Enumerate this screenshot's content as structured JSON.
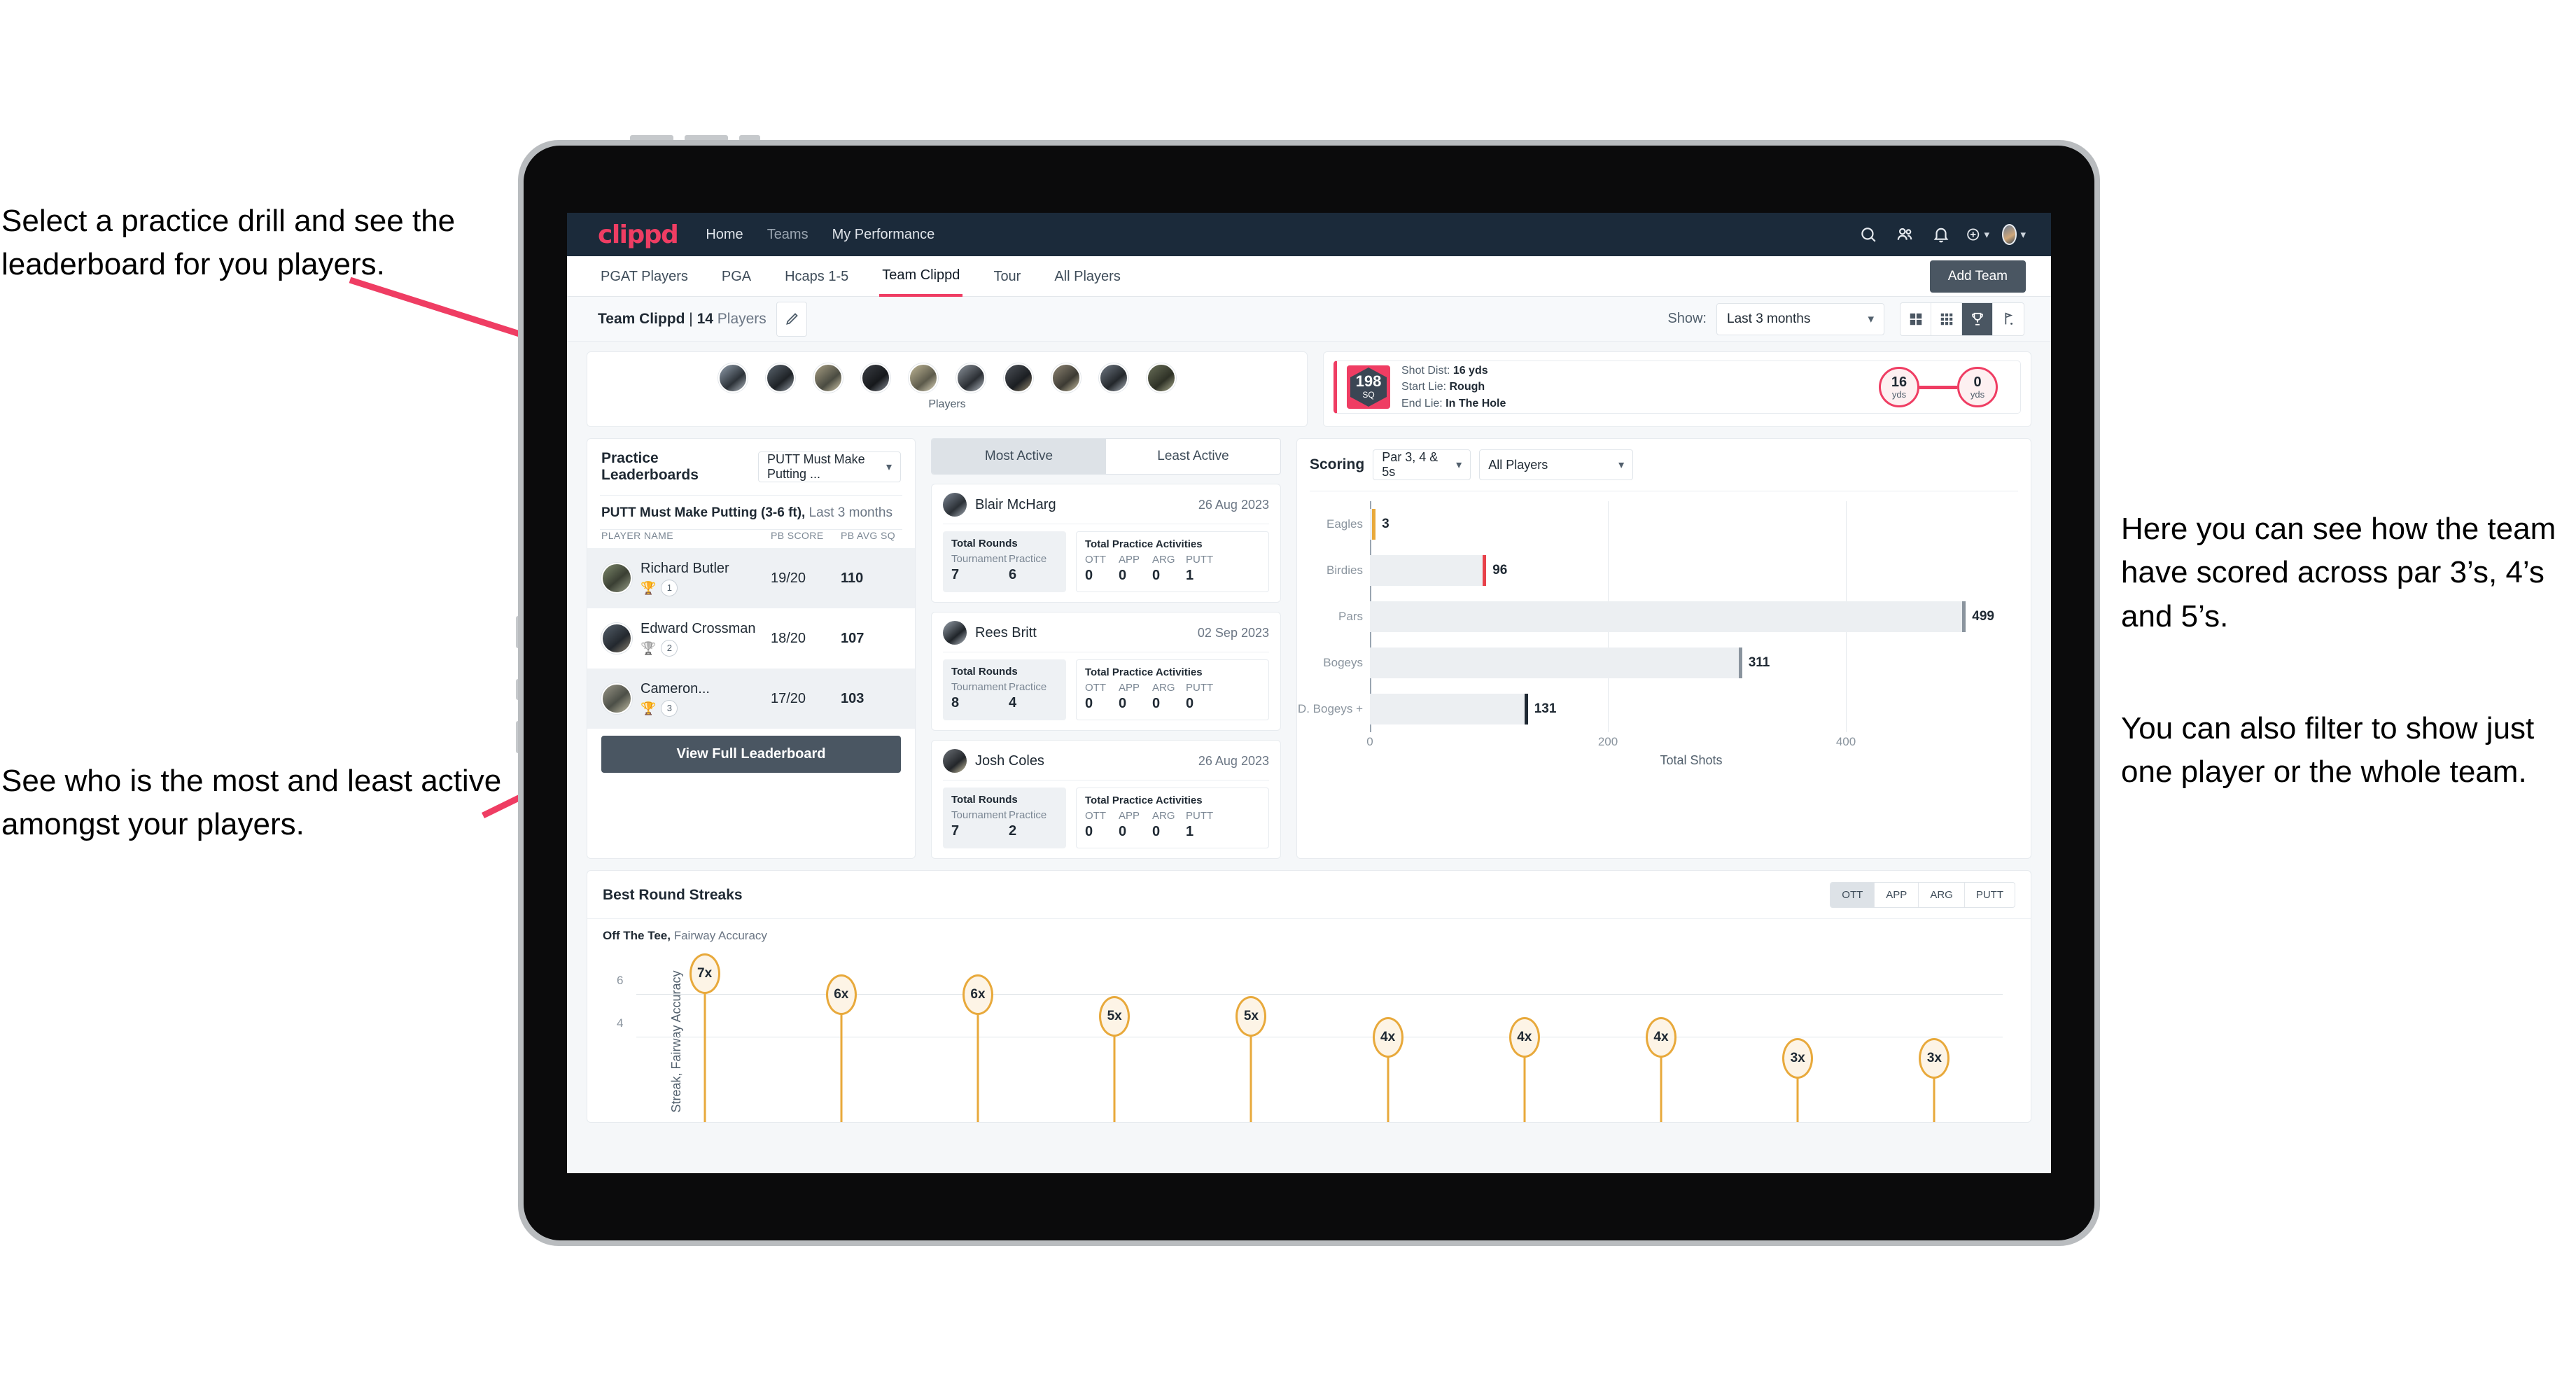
{
  "annotations": {
    "select_drill": "Select a practice drill and see the leaderboard for you players.",
    "most_least": "See who is the most and least active amongst your players.",
    "scoring": "Here you can see how the team have scored across par 3’s, 4’s and 5’s.",
    "filter": "You can also filter to show just one player or the whole team."
  },
  "colors": {
    "brand_pink": "#ef3d63",
    "navbar_dark": "#1b2a3a",
    "button_slate": "#4a5662",
    "amber": "#e8a93b"
  },
  "topnav": {
    "logo": "clippd",
    "links": [
      {
        "label": "Home",
        "active": true
      },
      {
        "label": "Teams",
        "active": false
      },
      {
        "label": "My Performance",
        "active": false
      }
    ],
    "icons": [
      "search-icon",
      "people-icon",
      "bell-icon",
      "plus-circle-icon",
      "avatar-icon"
    ]
  },
  "tabbar": {
    "tabs": [
      {
        "label": "PGAT Players",
        "active": false
      },
      {
        "label": "PGA",
        "active": false
      },
      {
        "label": "Hcaps 1-5",
        "active": false
      },
      {
        "label": "Team Clippd",
        "active": true
      },
      {
        "label": "Tour",
        "active": false
      },
      {
        "label": "All Players",
        "active": false
      }
    ],
    "add_team": "Add Team"
  },
  "toolbar": {
    "team_name": "Team Clippd",
    "separator": " | ",
    "player_count": "14",
    "players_word": "Players",
    "edit_icon": "pencil-icon",
    "show_label": "Show:",
    "show_value": "Last 3 months",
    "view_modes": [
      {
        "name": "grid-large-icon",
        "active": false
      },
      {
        "name": "grid-small-icon",
        "active": false
      },
      {
        "name": "trophy-icon",
        "active": true
      },
      {
        "name": "flag-icon",
        "active": false
      }
    ]
  },
  "players_strip": {
    "caption": "Players",
    "count": 10
  },
  "shot_card": {
    "sq_value": "198",
    "sq_unit": "SQ",
    "shot_dist_label": "Shot Dist:",
    "shot_dist_value": "16 yds",
    "start_lie_label": "Start Lie:",
    "start_lie_value": "Rough",
    "end_lie_label": "End Lie:",
    "end_lie_value": "In The Hole",
    "start_yards": "16",
    "start_unit": "yds",
    "end_yards": "0",
    "end_unit": "yds"
  },
  "leaderboard": {
    "title": "Practice Leaderboards",
    "drill_selected": "PUTT Must Make Putting ...",
    "subtitle_bold": "PUTT Must Make Putting (3-6 ft),",
    "subtitle_rest": "Last 3 months",
    "columns": [
      "PLAYER NAME",
      "PB SCORE",
      "PB AVG SQ"
    ],
    "rows": [
      {
        "name": "Richard Butler",
        "rank": "1",
        "trophy": "gold",
        "pb_score": "19/20",
        "pb_avg_sq": "110",
        "highlight": true
      },
      {
        "name": "Edward Crossman",
        "rank": "2",
        "trophy": "silver",
        "pb_score": "18/20",
        "pb_avg_sq": "107",
        "highlight": false
      },
      {
        "name": "Cameron...",
        "rank": "3",
        "trophy": "bronze",
        "pb_score": "17/20",
        "pb_avg_sq": "103",
        "highlight": true
      }
    ],
    "button": "View Full Leaderboard"
  },
  "activity": {
    "tabs": [
      {
        "label": "Most Active",
        "active": true
      },
      {
        "label": "Least Active",
        "active": false
      }
    ],
    "rounds_label": "Total Rounds",
    "rounds_cols": [
      "Tournament",
      "Practice"
    ],
    "practice_label": "Total Practice Activities",
    "practice_cols": [
      "OTT",
      "APP",
      "ARG",
      "PUTT"
    ],
    "cards": [
      {
        "name": "Blair McHarg",
        "date": "26 Aug 2023",
        "tournament": "7",
        "practice": "6",
        "ott": "0",
        "app": "0",
        "arg": "0",
        "putt": "1"
      },
      {
        "name": "Rees Britt",
        "date": "02 Sep 2023",
        "tournament": "8",
        "practice": "4",
        "ott": "0",
        "app": "0",
        "arg": "0",
        "putt": "0"
      },
      {
        "name": "Josh Coles",
        "date": "26 Aug 2023",
        "tournament": "7",
        "practice": "2",
        "ott": "0",
        "app": "0",
        "arg": "0",
        "putt": "1"
      }
    ]
  },
  "scoring": {
    "title": "Scoring",
    "par_filter": "Par 3, 4 & 5s",
    "player_filter": "All Players"
  },
  "streaks": {
    "title": "Best Round Streaks",
    "toggle": [
      {
        "label": "OTT",
        "active": true
      },
      {
        "label": "APP",
        "active": false
      },
      {
        "label": "ARG",
        "active": false
      },
      {
        "label": "PUTT",
        "active": false
      }
    ],
    "subtitle_bold": "Off The Tee,",
    "subtitle_rest": "Fairway Accuracy"
  },
  "chart_data": [
    {
      "type": "bar",
      "orientation": "horizontal",
      "title": "Scoring",
      "categories": [
        "Eagles",
        "Birdies",
        "Pars",
        "Bogeys",
        "D. Bogeys +"
      ],
      "values": [
        3,
        96,
        499,
        311,
        131
      ],
      "cap_colors": [
        "#e8a93b",
        "#e8414a",
        "#8a949e",
        "#8a949e",
        "#1f2933"
      ],
      "xlabel": "Total Shots",
      "ylabel": "",
      "xticks": [
        0,
        200,
        400
      ],
      "xlim": [
        0,
        540
      ],
      "grid": true,
      "legend": "none"
    },
    {
      "type": "scatter",
      "title": "Best Round Streaks",
      "subtitle": "Off The Tee, Fairway Accuracy",
      "ylabel": "Streak, Fairway Accuracy",
      "yticks": [
        4,
        6
      ],
      "ylim": [
        0,
        7.6
      ],
      "labels": [
        "7x",
        "6x",
        "6x",
        "5x",
        "5x",
        "4x",
        "4x",
        "4x",
        "3x",
        "3x"
      ],
      "values": [
        7,
        6,
        6,
        5,
        5,
        4,
        4,
        4,
        3,
        3
      ],
      "grid": true,
      "legend": "none"
    }
  ]
}
